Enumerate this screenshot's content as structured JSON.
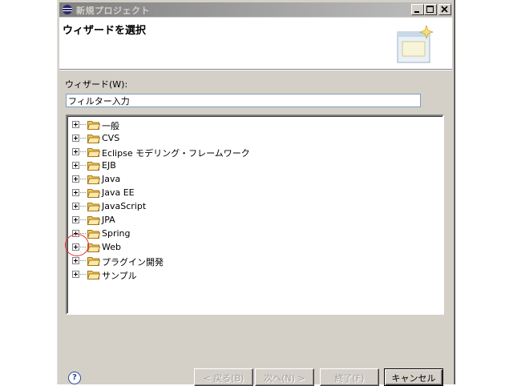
{
  "window": {
    "title": "新規プロジェクト"
  },
  "banner": {
    "title": "ウィザードを選択"
  },
  "wizard": {
    "label": "ウィザード(W):",
    "filter_value": "フィルター入力"
  },
  "tree": {
    "items": [
      {
        "label": "一般"
      },
      {
        "label": "CVS"
      },
      {
        "label": "Eclipse モデリング・フレームワーク"
      },
      {
        "label": "EJB"
      },
      {
        "label": "Java"
      },
      {
        "label": "Java EE"
      },
      {
        "label": "JavaScript"
      },
      {
        "label": "JPA"
      },
      {
        "label": "Spring"
      },
      {
        "label": "Web"
      },
      {
        "label": "プラグイン開発"
      },
      {
        "label": "サンプル"
      }
    ]
  },
  "buttons": {
    "help": "?",
    "back": "< 戻る(B)",
    "next": "次へ(N) >",
    "finish": "終了(F)",
    "cancel": "キャンセル"
  },
  "colors": {
    "annotation_circle": "#e03030",
    "folder": "#f0c860"
  }
}
